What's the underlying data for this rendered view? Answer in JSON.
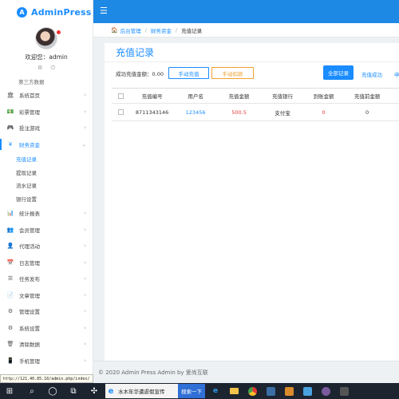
{
  "app": {
    "name": "AdminPress",
    "logo_letter": "A",
    "brand_color": "#1a8cff"
  },
  "profile": {
    "welcome": "欢迎您：admin",
    "icons": [
      "gear-icon",
      "power-icon"
    ]
  },
  "sidebar": {
    "section_title": "第三方数据",
    "items": [
      {
        "icon": "bank-icon",
        "glyph": "🏛",
        "label": "系统首页",
        "chevron": "›",
        "active": false
      },
      {
        "icon": "money-icon",
        "glyph": "💵",
        "label": "彩票管理",
        "chevron": "›",
        "active": false
      },
      {
        "icon": "gamepad-icon",
        "glyph": "🎮",
        "label": "投注游戏",
        "chevron": "›",
        "active": false
      },
      {
        "icon": "yen-icon",
        "glyph": "¥",
        "label": "财务资金",
        "chevron": "⌄",
        "active": true,
        "children": [
          {
            "label": "充值记录",
            "current": true
          },
          {
            "label": "提现记录",
            "current": false
          },
          {
            "label": "流水记录",
            "current": false
          },
          {
            "label": "银行设置",
            "current": false
          }
        ]
      },
      {
        "icon": "bar-chart-icon",
        "glyph": "📊",
        "label": "统计报表",
        "chevron": "›",
        "active": false
      },
      {
        "icon": "users-icon",
        "glyph": "👥",
        "label": "会员管理",
        "chevron": "›",
        "active": false
      },
      {
        "icon": "agent-icon",
        "glyph": "👤",
        "label": "代理活动",
        "chevron": "›",
        "active": false
      },
      {
        "icon": "calendar-icon",
        "glyph": "📅",
        "label": "日志管理",
        "chevron": "›",
        "active": false
      },
      {
        "icon": "list-icon",
        "glyph": "☰",
        "label": "任务发布",
        "chevron": "›",
        "active": false
      },
      {
        "icon": "document-icon",
        "glyph": "📄",
        "label": "文章管理",
        "chevron": "›",
        "active": false
      },
      {
        "icon": "settings-icon",
        "glyph": "⚙",
        "label": "管理设置",
        "chevron": "›",
        "active": false
      },
      {
        "icon": "cog-icon",
        "glyph": "⚙",
        "label": "系统设置",
        "chevron": "›",
        "active": false
      },
      {
        "icon": "trash-icon",
        "glyph": "🗑",
        "label": "清除数据",
        "chevron": "›",
        "active": false
      },
      {
        "icon": "mobile-icon",
        "glyph": "📱",
        "label": "手机管理",
        "chevron": "›",
        "active": false
      }
    ]
  },
  "status_url": "http://121.40.85.18/admin.php/index/",
  "breadcrumb": {
    "home": "后台管理",
    "parent": "财务资金",
    "current": "充值记录",
    "separator": "/"
  },
  "main": {
    "title": "充值记录",
    "success_amount_label": "成功充值金额：0.00",
    "btn_manual_recharge": "手动充值",
    "btn_manual_deduct": "手动扣款",
    "btn_all_records": "全部记录",
    "filter_success": "充值成功",
    "filter_pending": "申"
  },
  "table": {
    "columns": [
      "充值编号",
      "用户名",
      "充值金额",
      "充值银行",
      "到账金额",
      "充值前金额"
    ],
    "rows": [
      {
        "order_no": "8711343146",
        "username": "123456",
        "amount": "500.5",
        "bank": "支付宝",
        "arrived": "0",
        "before": "0"
      }
    ]
  },
  "footer": {
    "text": "© 2020 Admin Press Admin by 爱尚互联"
  },
  "taskbar": {
    "ie_text": "水木年华遭虐假宣传",
    "ie_button": "搜索一下"
  },
  "colors": {
    "topbar": "#1e88e5",
    "accent": "#1a8cff",
    "danger": "#e53935",
    "warning": "#f0a030"
  }
}
